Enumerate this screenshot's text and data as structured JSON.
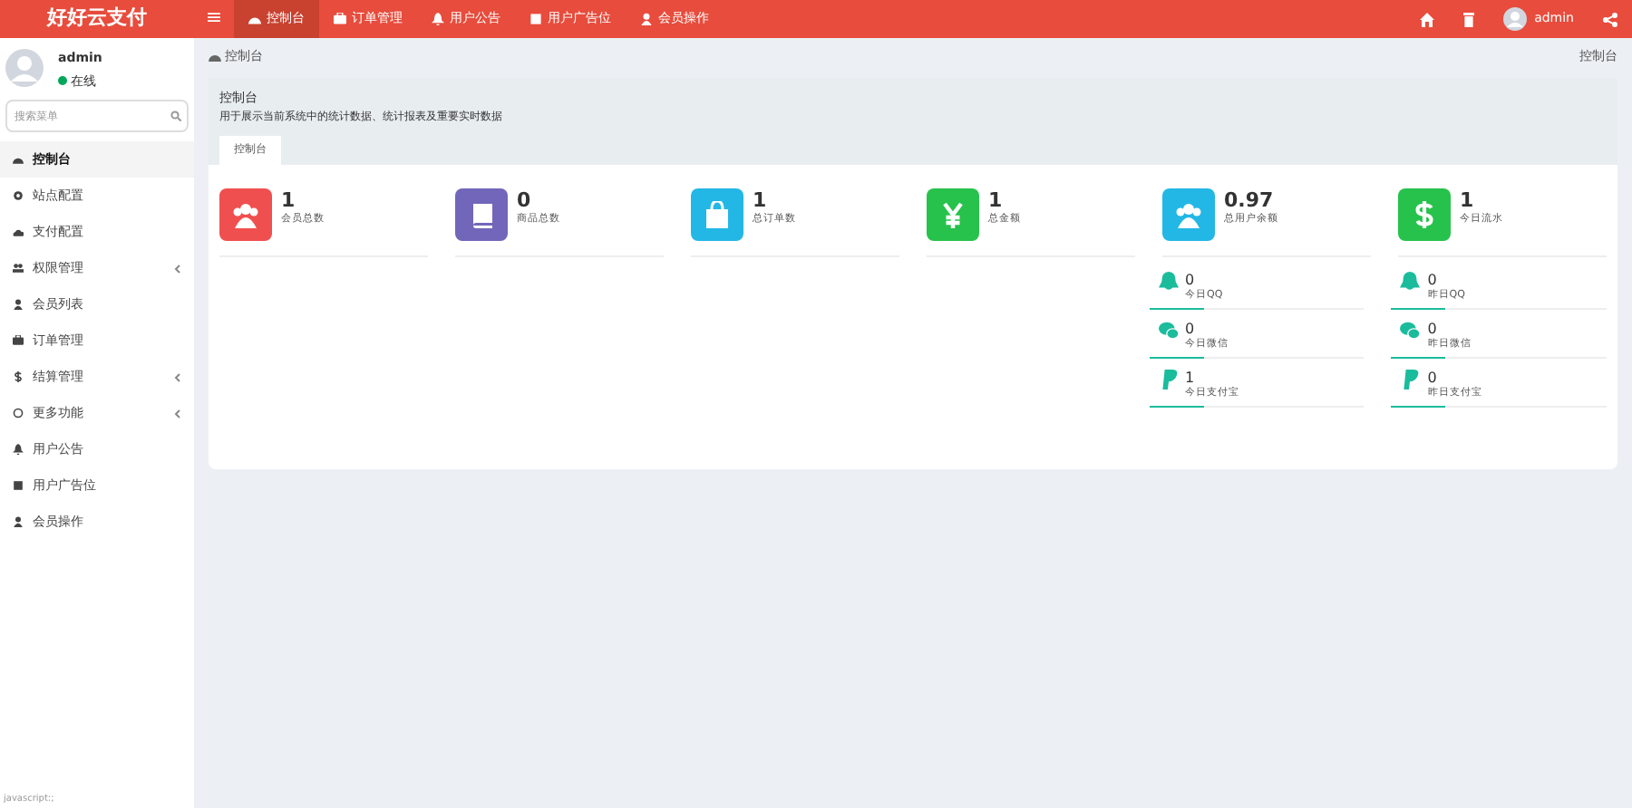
{
  "header": {
    "logo": "好好云支付",
    "menu_toggle": "≡",
    "nav": [
      {
        "label": "控制台",
        "kind": "dashboard",
        "selected": true
      },
      {
        "label": "订单管理",
        "kind": "box",
        "selected": false
      },
      {
        "label": "用户公告",
        "kind": "bell",
        "selected": false
      },
      {
        "label": "用户广告位",
        "kind": "square",
        "selected": false
      },
      {
        "label": "会员操作",
        "kind": "user",
        "selected": false
      }
    ],
    "user": "admin"
  },
  "sidebar": {
    "user": {
      "name": "admin",
      "status": "在线"
    },
    "search": {
      "placeholder": "搜索菜单"
    },
    "items": [
      {
        "label": "控制台",
        "kind": "dashboard",
        "selected": true,
        "expandable": false
      },
      {
        "label": "站点配置",
        "kind": "gear",
        "selected": false,
        "expandable": false
      },
      {
        "label": "支付配置",
        "kind": "cloud",
        "selected": false,
        "expandable": false
      },
      {
        "label": "权限管理",
        "kind": "group",
        "selected": false,
        "expandable": true
      },
      {
        "label": "会员列表",
        "kind": "user",
        "selected": false,
        "expandable": false
      },
      {
        "label": "订单管理",
        "kind": "box",
        "selected": false,
        "expandable": false
      },
      {
        "label": "结算管理",
        "kind": "dollar",
        "selected": false,
        "expandable": true
      },
      {
        "label": "更多功能",
        "kind": "circle",
        "selected": false,
        "expandable": true
      },
      {
        "label": "用户公告",
        "kind": "bell",
        "selected": false,
        "expandable": false
      },
      {
        "label": "用户广告位",
        "kind": "square",
        "selected": false,
        "expandable": false
      },
      {
        "label": "会员操作",
        "kind": "user",
        "selected": false,
        "expandable": false
      }
    ]
  },
  "breadcrumb": {
    "current": "控制台",
    "right": "控制台"
  },
  "panel": {
    "title": "控制台",
    "description": "用于展示当前系统中的统计数据、统计报表及重要实时数据",
    "tabs": [
      {
        "label": "控制台",
        "selected": true
      }
    ]
  },
  "stats": [
    {
      "value": "1",
      "label": "会员总数",
      "kind": "users",
      "color": "#f04f4f"
    },
    {
      "value": "0",
      "label": "商品总数",
      "kind": "book",
      "color": "#7266ba"
    },
    {
      "value": "1",
      "label": "总订单数",
      "kind": "bag",
      "color": "#23b7e5"
    },
    {
      "value": "1",
      "label": "总金额",
      "kind": "yen",
      "color": "#27c24c"
    },
    {
      "value": "0.97",
      "label": "总用户余额",
      "kind": "users",
      "color": "#23b7e5"
    },
    {
      "value": "1",
      "label": "今日流水",
      "kind": "dollar",
      "color": "#27c24c"
    }
  ],
  "mini_stats": [
    {
      "value": "0",
      "label": "今日QQ",
      "kind": "qq"
    },
    {
      "value": "0",
      "label": "昨日QQ",
      "kind": "qq"
    },
    {
      "value": "0",
      "label": "今日微信",
      "kind": "wechat"
    },
    {
      "value": "0",
      "label": "昨日微信",
      "kind": "wechat"
    },
    {
      "value": "1",
      "label": "今日支付宝",
      "kind": "pay"
    },
    {
      "value": "0",
      "label": "昨日支付宝",
      "kind": "pay"
    }
  ],
  "status_bar": "javascript:;"
}
